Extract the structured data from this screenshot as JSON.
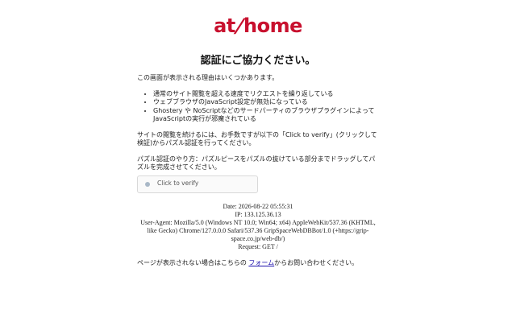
{
  "brand": {
    "logo_part1": "at",
    "logo_slash": "/",
    "logo_part2": "home",
    "color": "#c8102e"
  },
  "title": "認証にご協力ください。",
  "intro": "この画面が表示される理由はいくつかあります。",
  "reasons": [
    "通常のサイト閲覧を超える速度でリクエストを繰り返している",
    "ウェブブラウザのJavaScript設定が無効になっている",
    "Ghostery や NoScriptなどのサードパーティのブラウザプラグインによって JavaScriptの実行が邪魔されている"
  ],
  "instruction": "サイトの閲覧を続けるには、お手数ですが以下の「Click to verify」(クリックして検証)からパズル認証を行ってください。",
  "puzzle_help": "パズル認証のやり方：パズルピースをパズルの抜けている部分までドラッグしてパズルを完成させてください。",
  "verify": {
    "label": "Click to verify",
    "icon": "circle-dot-icon"
  },
  "meta": {
    "date": "Date: 2026-08-22 05:55:31",
    "ip": "IP: 133.125.36.13",
    "user_agent": "User-Agent: Mozilla/5.0 (Windows NT 10.0; Win64; x64) AppleWebKit/537.36 (KHTML, like Gecko) Chrome/127.0.0.0 Safari/537.36 GripSpaceWebDBBot/1.0 (+https://grip-space.co.jp/web-db/)",
    "request": "Request: GET /"
  },
  "footer": {
    "before": "ページが表示されない場合はこちらの ",
    "link": "フォーム",
    "after": "からお問い合わせください。"
  }
}
